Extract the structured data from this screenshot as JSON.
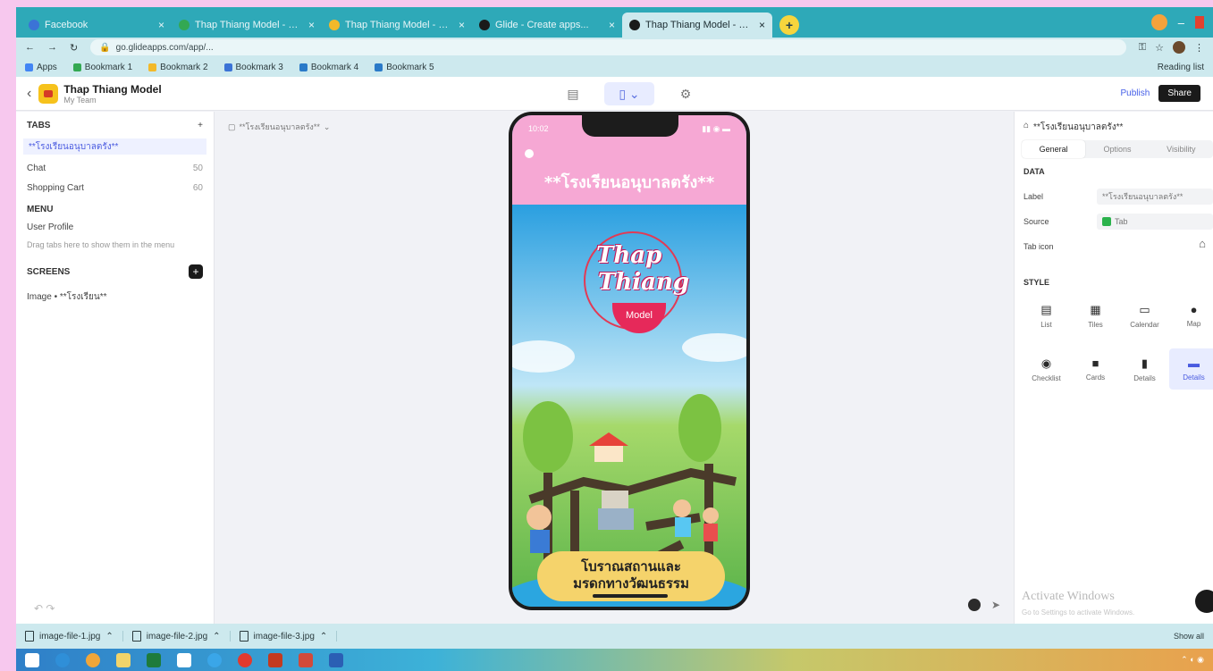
{
  "browser": {
    "tabs": [
      {
        "label": "Facebook",
        "color": "#3b73d6"
      },
      {
        "label": "Thap Thiang Model - Google Drive",
        "color": "#33a852"
      },
      {
        "label": "Thap Thiang Model - Google Slides",
        "color": "#f3b92a"
      },
      {
        "label": "Glide - Create apps...",
        "color": "#1a1a1a"
      },
      {
        "label": "Thap Thiang Model - Glide",
        "color": "#1a1a1a"
      }
    ],
    "new_tab": "+",
    "url": "go.glideapps.com/app/...",
    "bookmarks": [
      {
        "label": "Apps",
        "color": "#4285f4"
      },
      {
        "label": "Bookmark 1",
        "color": "#33a852"
      },
      {
        "label": "Bookmark 2",
        "color": "#f3b92a"
      },
      {
        "label": "Bookmark 3",
        "color": "#3b73d6"
      },
      {
        "label": "Bookmark 4",
        "color": "#2a7ac8"
      },
      {
        "label": "Bookmark 5",
        "color": "#2a7ac8"
      }
    ],
    "bookmarks_right": "Reading list"
  },
  "app": {
    "title": "Thap Thiang Model",
    "subtitle": "My Team",
    "preview_label": "Publish",
    "share_label": "Share"
  },
  "left_panel": {
    "tabs_header": "TABS",
    "items": [
      {
        "label": "**โรงเรียนอนุบาลตรัง**",
        "badge": ""
      },
      {
        "label": "Chat",
        "badge": "50"
      },
      {
        "label": "Shopping Cart",
        "badge": "60"
      }
    ],
    "menu_header": "MENU",
    "menu_items": [
      {
        "label": "User Profile"
      },
      {
        "label": "Drag tabs here to show them in the menu"
      }
    ],
    "screens_header": "SCREENS",
    "screen_item": "Image • **โรงเรียน**"
  },
  "canvas": {
    "screen_select": "**โรงเรียนอนุบาลตรัง**",
    "phone": {
      "time": "10:02",
      "title_th": "**โรงเรียนอนุบาลตรัง**",
      "logo_line1": "Thap",
      "logo_line2": "Thiang",
      "logo_badge": "Model",
      "banner_line1": "โบราณสถานและ",
      "banner_line2": "มรดกทางวัฒนธรรม"
    }
  },
  "right_panel": {
    "title": "**โรงเรียนอนุบาลตรัง**",
    "tabs": [
      "General",
      "Options",
      "Visibility"
    ],
    "data_label": "DATA",
    "label_key": "Label",
    "label_val": "**โรงเรียนอนุบาลตรัง**",
    "source_key": "Source",
    "source_val": "Tab",
    "tab_icon_key": "Tab icon",
    "style_label": "STYLE",
    "components": [
      {
        "label": "List",
        "icon": "list-icon"
      },
      {
        "label": "Tiles",
        "icon": "tiles-icon"
      },
      {
        "label": "Calendar",
        "icon": "calendar-icon"
      },
      {
        "label": "Map",
        "icon": "map-pin-icon"
      },
      {
        "label": "Checklist",
        "icon": "checklist-icon"
      },
      {
        "label": "Cards",
        "icon": "cards-icon"
      },
      {
        "label": "Details",
        "icon": "details-icon"
      },
      {
        "label": "Details",
        "icon": "details-selected-icon"
      }
    ],
    "activate_line1": "Activate Windows",
    "activate_line2": "Go to Settings to activate Windows."
  },
  "downloads": {
    "items": [
      {
        "label": "image-file-1.jpg"
      },
      {
        "label": "image-file-2.jpg"
      },
      {
        "label": "image-file-3.jpg"
      }
    ],
    "show_all": "Show all"
  },
  "colors": {
    "tabbar": "#2ea9b8",
    "accent": "#5a6fe0",
    "phone_header": "#f6a8d4",
    "phone_sky": "#2ba6e0"
  }
}
